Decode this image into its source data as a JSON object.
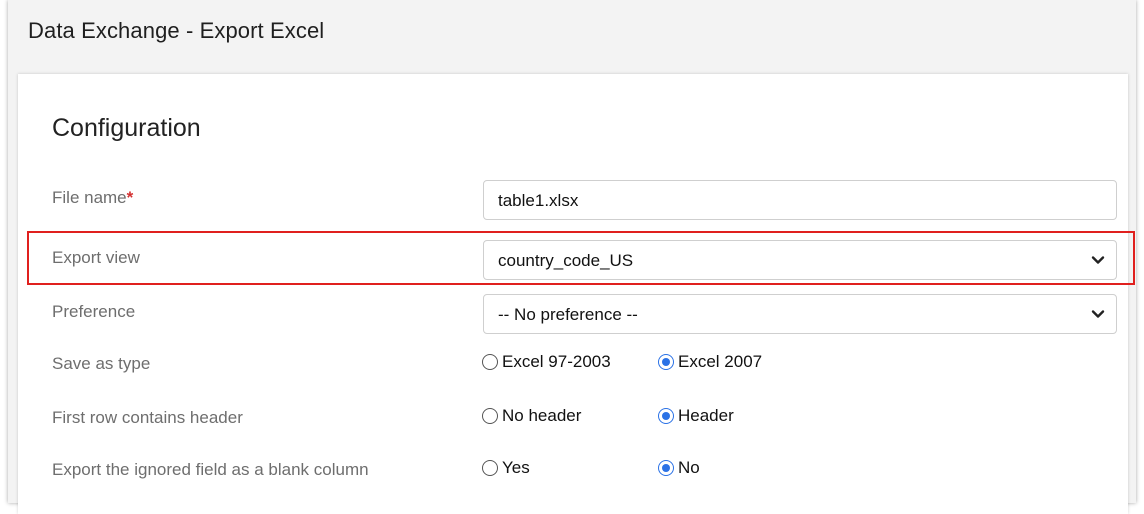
{
  "window": {
    "title": "Data Exchange - Export Excel"
  },
  "section": {
    "title": "Configuration"
  },
  "fields": {
    "file_name": {
      "label": "File name",
      "required_marker": "*",
      "value": "table1.xlsx"
    },
    "export_view": {
      "label": "Export view",
      "value": "country_code_US"
    },
    "preference": {
      "label": "Preference",
      "value": "-- No preference --"
    },
    "save_as_type": {
      "label": "Save as type",
      "options": [
        "Excel 97-2003",
        "Excel 2007"
      ],
      "selected": "Excel 2007"
    },
    "first_row_header": {
      "label": "First row contains header",
      "options": [
        "No header",
        "Header"
      ],
      "selected": "Header"
    },
    "export_ignored_blank": {
      "label": "Export the ignored field as a blank column",
      "options": [
        "Yes",
        "No"
      ],
      "selected": "No"
    }
  },
  "colors": {
    "accent": "#2b72e6",
    "highlight_border": "#e0201e",
    "required": "#d32f2f"
  },
  "icons": {
    "select_arrow": "chevron-down-icon"
  }
}
